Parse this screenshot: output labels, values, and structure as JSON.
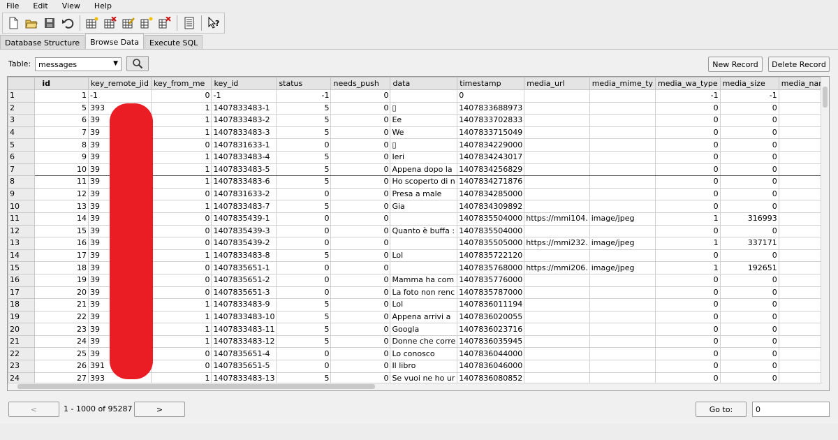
{
  "menu": [
    "File",
    "Edit",
    "View",
    "Help"
  ],
  "toolbar_icons": [
    "new-database-icon",
    "open-database-icon",
    "save-icon",
    "undo-icon",
    "create-table-icon",
    "delete-table-icon",
    "modify-table-icon",
    "create-index-icon",
    "delete-index-icon",
    "preferences-icon",
    "whats-this-icon"
  ],
  "tabs": [
    "Database Structure",
    "Browse Data",
    "Execute SQL"
  ],
  "active_tab": "Browse Data",
  "table_label": "Table:",
  "table_value": "messages",
  "new_record": "New Record",
  "delete_record": "Delete Record",
  "columns": [
    "id",
    "key_remote_jid",
    "key_from_me",
    "key_id",
    "status",
    "needs_push",
    "data",
    "timestamp",
    "media_url",
    "media_mime_ty",
    "media_wa_type",
    "media_size",
    "media_nam"
  ],
  "rows": [
    [
      "1",
      "1",
      "-1",
      "0",
      "-1",
      "-1",
      "0",
      "",
      "0",
      "",
      "",
      "-1",
      "-1"
    ],
    [
      "2",
      "5",
      "393",
      "1",
      "1407833483-1",
      "5",
      "0",
      "▯",
      "1407833688973",
      "",
      "",
      "0",
      "0"
    ],
    [
      "3",
      "6",
      "39",
      "1",
      "1407833483-2",
      "5",
      "0",
      "Ee",
      "1407833702833",
      "",
      "",
      "0",
      "0"
    ],
    [
      "4",
      "7",
      "39",
      "1",
      "1407833483-3",
      "5",
      "0",
      "We",
      "1407833715049",
      "",
      "",
      "0",
      "0"
    ],
    [
      "5",
      "8",
      "39",
      "0",
      "1407831633-1",
      "0",
      "0",
      "▯",
      "1407834229000",
      "",
      "",
      "0",
      "0"
    ],
    [
      "6",
      "9",
      "39",
      "1",
      "1407833483-4",
      "5",
      "0",
      "Ieri",
      "1407834243017",
      "",
      "",
      "0",
      "0"
    ],
    [
      "7",
      "10",
      "39",
      "1",
      "1407833483-5",
      "5",
      "0",
      "Appena dopo la",
      "1407834256829",
      "",
      "",
      "0",
      "0"
    ],
    [
      "8",
      "11",
      "39",
      "1",
      "1407833483-6",
      "5",
      "0",
      "Ho scoperto di n",
      "1407834271876",
      "",
      "",
      "0",
      "0"
    ],
    [
      "9",
      "12",
      "39",
      "0",
      "1407831633-2",
      "0",
      "0",
      "Presa a male",
      "1407834285000",
      "",
      "",
      "0",
      "0"
    ],
    [
      "10",
      "13",
      "39",
      "1",
      "1407833483-7",
      "5",
      "0",
      "Gia",
      "1407834309892",
      "",
      "",
      "0",
      "0"
    ],
    [
      "11",
      "14",
      "39",
      "0",
      "1407835439-1",
      "0",
      "0",
      "",
      "1407835504000",
      "https://mmi104.",
      "image/jpeg",
      "1",
      "316993"
    ],
    [
      "12",
      "15",
      "39",
      "0",
      "1407835439-3",
      "0",
      "0",
      "Quanto è buffa :",
      "1407835504000",
      "",
      "",
      "0",
      "0"
    ],
    [
      "13",
      "16",
      "39",
      "0",
      "1407835439-2",
      "0",
      "0",
      "",
      "1407835505000",
      "https://mmi232.",
      "image/jpeg",
      "1",
      "337171"
    ],
    [
      "14",
      "17",
      "39",
      "1",
      "1407833483-8",
      "5",
      "0",
      "Lol",
      "1407835722120",
      "",
      "",
      "0",
      "0"
    ],
    [
      "15",
      "18",
      "39",
      "0",
      "1407835651-1",
      "0",
      "0",
      "",
      "1407835768000",
      "https://mmi206.",
      "image/jpeg",
      "1",
      "192651"
    ],
    [
      "16",
      "19",
      "39",
      "0",
      "1407835651-2",
      "0",
      "0",
      "Mamma ha com",
      "1407835776000",
      "",
      "",
      "0",
      "0"
    ],
    [
      "17",
      "20",
      "39",
      "0",
      "1407835651-3",
      "0",
      "0",
      "La foto non renc",
      "1407835787000",
      "",
      "",
      "0",
      "0"
    ],
    [
      "18",
      "21",
      "39",
      "1",
      "1407833483-9",
      "5",
      "0",
      "Lol",
      "1407836011194",
      "",
      "",
      "0",
      "0"
    ],
    [
      "19",
      "22",
      "39",
      "1",
      "1407833483-10",
      "5",
      "0",
      "Appena arrivi a",
      "1407836020055",
      "",
      "",
      "0",
      "0"
    ],
    [
      "20",
      "23",
      "39",
      "1",
      "1407833483-11",
      "5",
      "0",
      "Googla",
      "1407836023716",
      "",
      "",
      "0",
      "0"
    ],
    [
      "21",
      "24",
      "39",
      "1",
      "1407833483-12",
      "5",
      "0",
      "Donne che corre",
      "1407836035945",
      "",
      "",
      "0",
      "0"
    ],
    [
      "22",
      "25",
      "39",
      "0",
      "1407835651-4",
      "0",
      "0",
      "Lo conosco",
      "1407836044000",
      "",
      "",
      "0",
      "0"
    ],
    [
      "23",
      "26",
      "391",
      "0",
      "1407835651-5",
      "0",
      "0",
      "Il libro",
      "1407836046000",
      "",
      "",
      "0",
      "0"
    ],
    [
      "24",
      "27",
      "393",
      "1",
      "1407833483-13",
      "5",
      "0",
      "Se vuoi ne ho ur",
      "1407836080852",
      "",
      "",
      "0",
      "0"
    ]
  ],
  "prev_button": "<",
  "record_range": "1 - 1000 of 95287",
  "next_button": ">",
  "goto_button": "Go to:",
  "goto_value": "0",
  "colors": {
    "redaction": "#ea1c24"
  }
}
